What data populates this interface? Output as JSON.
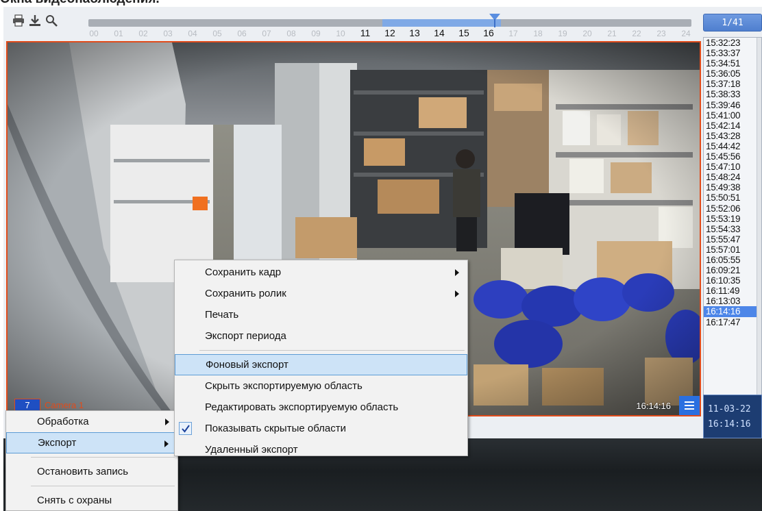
{
  "header": {
    "title": "Окна видеонаблюдения."
  },
  "toolbar": {
    "icons": [
      "print-icon",
      "download-icon",
      "search-icon"
    ]
  },
  "timeline": {
    "hours": [
      "00",
      "01",
      "02",
      "03",
      "04",
      "05",
      "06",
      "07",
      "08",
      "09",
      "10",
      "11",
      "12",
      "13",
      "14",
      "15",
      "16",
      "17",
      "18",
      "19",
      "20",
      "21",
      "22",
      "23",
      "24"
    ],
    "active_hours": [
      "11",
      "12",
      "13",
      "14",
      "15",
      "16"
    ],
    "selection_start_hour": 11.7,
    "selection_end_hour": 16.5,
    "cursor_hour": 16.24
  },
  "page_counter": "1/41",
  "time_list": {
    "items": [
      "15:32:23",
      "15:33:37",
      "15:34:51",
      "15:36:05",
      "15:37:18",
      "15:38:33",
      "15:39:46",
      "15:41:00",
      "15:42:14",
      "15:43:28",
      "15:44:42",
      "15:45:56",
      "15:47:10",
      "15:48:24",
      "15:49:38",
      "15:50:51",
      "15:52:06",
      "15:53:19",
      "15:54:33",
      "15:55:47",
      "15:57:01",
      "16:05:55",
      "16:09:21",
      "16:10:35",
      "16:11:49",
      "16:13:03",
      "16:14:16",
      "16:17:47"
    ],
    "selected_index": 26
  },
  "datetime": {
    "date": "11-03-22",
    "time": "16:14:16"
  },
  "camera": {
    "number": "7",
    "name": "Camera 1",
    "timestamp": "16:14:16"
  },
  "left_menu": {
    "items": [
      {
        "label": "Обработка",
        "submenu": true
      },
      {
        "label": "Экспорт",
        "submenu": true,
        "highlight": true
      },
      {
        "label": "Остановить запись"
      },
      {
        "label": "Снять с охраны"
      }
    ]
  },
  "right_menu": {
    "items": [
      {
        "label": "Сохранить кадр",
        "submenu": true
      },
      {
        "label": "Сохранить ролик",
        "submenu": true
      },
      {
        "label": "Печать"
      },
      {
        "label": "Экспорт периода"
      },
      {
        "label": "Фоновый экспорт",
        "highlight": true
      },
      {
        "label": "Скрыть экспортируемую область"
      },
      {
        "label": "Редактировать экспортируемую область"
      },
      {
        "label": "Показывать скрытые области",
        "checked": true
      },
      {
        "label": "Удаленный экспорт"
      }
    ]
  },
  "colors": {
    "accent": "#4d86e8",
    "camera_border": "#e14b1a",
    "menu_highlight": "#cde3f7"
  }
}
